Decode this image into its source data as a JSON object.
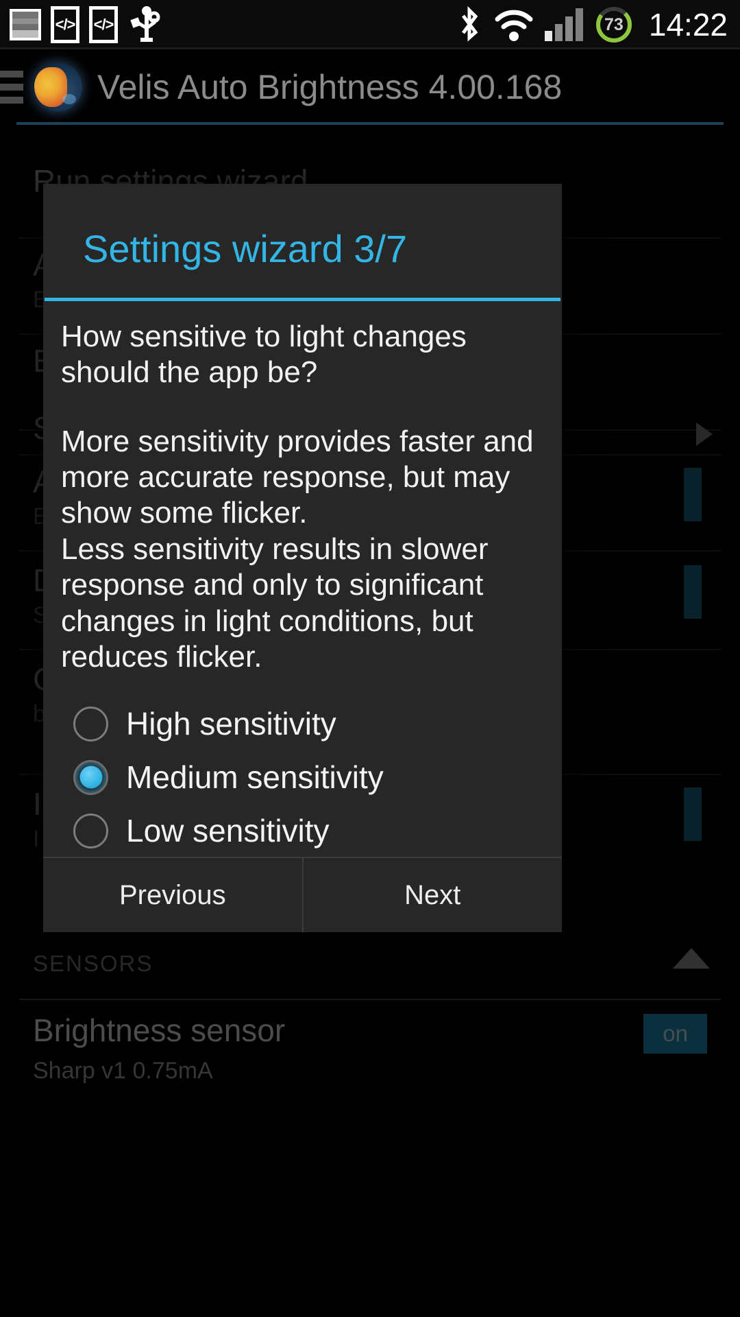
{
  "statusbar": {
    "icons_left": [
      "screenshot-icon",
      "usb-debug-icon",
      "usb-debug-icon-2",
      "usb-icon"
    ],
    "icons_right": [
      "bluetooth-icon",
      "wifi-icon",
      "signal-icon",
      "battery-icon"
    ],
    "battery_level": "73",
    "time": "14:22"
  },
  "actionbar": {
    "menu_icon": "hamburger-menu-icon",
    "app_icon": "velis-globe-icon",
    "title": "Velis Auto Brightness 4.00.168"
  },
  "background": {
    "rows": [
      {
        "title": "Run settings wizard",
        "sub": ""
      },
      {
        "title": "A",
        "sub": "E"
      },
      {
        "title": "E",
        "sub": ""
      },
      {
        "title": "S",
        "sub": ""
      },
      {
        "title": "A",
        "sub": "E"
      },
      {
        "title": "D",
        "sub": "S"
      },
      {
        "title": "C",
        "sub": "b"
      },
      {
        "title": "I",
        "sub": "I"
      }
    ],
    "sensors_header": "SENSORS",
    "sensor_name": "Brightness sensor",
    "sensor_state": "on",
    "sensor_detail": "Sharp v1 0.75mA",
    "collapse_icon": "chevron-up-icon"
  },
  "dialog": {
    "title": "Settings wizard 3/7",
    "body_para_1": "How sensitive to light changes should the app be?",
    "body_para_2": "More sensitivity provides faster and more accurate response, but may show some flicker.",
    "body_para_3": "Less sensitivity results in slower response and only to significant changes in light conditions, but reduces flicker.",
    "options": [
      {
        "label": "High sensitivity",
        "selected": false
      },
      {
        "label": "Medium sensitivity",
        "selected": true
      },
      {
        "label": "Low sensitivity",
        "selected": false
      }
    ],
    "previous_label": "Previous",
    "next_label": "Next",
    "accent_color": "#33b5e5",
    "surface_color": "#272727"
  }
}
